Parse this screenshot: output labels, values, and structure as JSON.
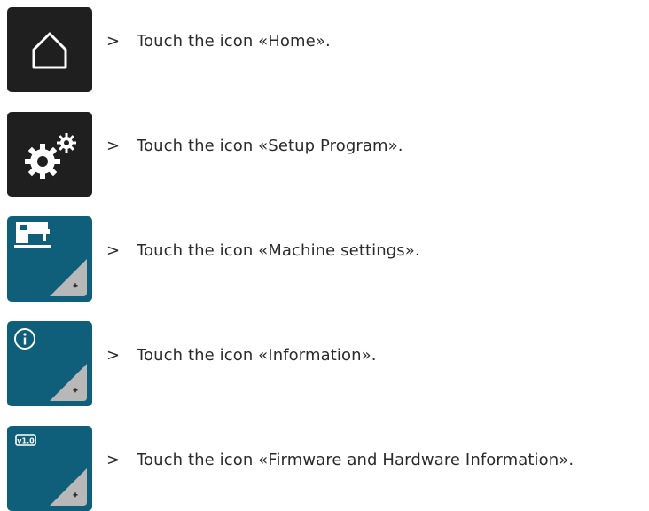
{
  "steps": [
    {
      "icon": "home-icon",
      "marker": ">",
      "text": "Touch the icon «Home»."
    },
    {
      "icon": "setup-program-gears-icon",
      "marker": ">",
      "text": "Touch the icon «Setup Program»."
    },
    {
      "icon": "machine-settings-sewing-machine-icon",
      "marker": ">",
      "text": "Touch the icon «Machine settings»."
    },
    {
      "icon": "information-icon",
      "marker": ">",
      "text": "Touch the icon «Information»."
    },
    {
      "icon": "firmware-version-icon",
      "version_label": "v1.0",
      "marker": ">",
      "text": "Touch the icon «Firmware and Hardware Information»."
    }
  ],
  "colors": {
    "dark_tile": "#1f1f1f",
    "blue_tile": "#0f5f7a",
    "corner_gray": "#b8b8b8"
  }
}
